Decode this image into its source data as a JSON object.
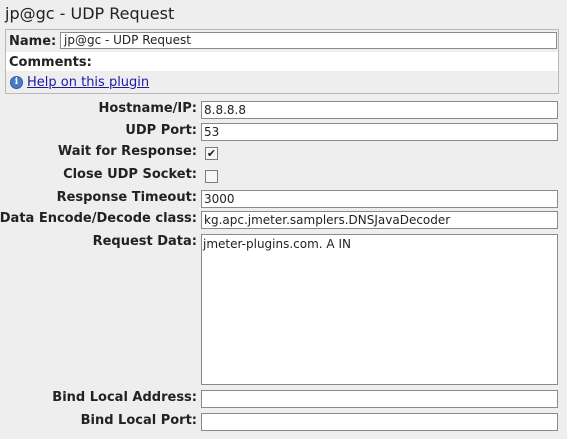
{
  "title": "jp@gc - UDP Request",
  "name_label": "Name:",
  "name_value": "jp@gc - UDP Request",
  "comments_label": "Comments:",
  "help_icon": "info-icon",
  "help_link": "Help on this plugin",
  "fields": {
    "hostname": {
      "label": "Hostname/IP:",
      "value": "8.8.8.8"
    },
    "udp_port": {
      "label": "UDP Port:",
      "value": "53"
    },
    "wait_response": {
      "label": "Wait for Response:",
      "checked": true
    },
    "close_socket": {
      "label": "Close UDP Socket:",
      "checked": false
    },
    "response_timeout": {
      "label": "Response Timeout:",
      "value": "3000"
    },
    "encode_class": {
      "label": "Data Encode/Decode class:",
      "value": "kg.apc.jmeter.samplers.DNSJavaDecoder"
    },
    "request_data": {
      "label": "Request Data:",
      "value": "jmeter-plugins.com. A IN"
    },
    "bind_address": {
      "label": "Bind Local Address:",
      "value": ""
    },
    "bind_port": {
      "label": "Bind Local Port:",
      "value": ""
    }
  },
  "checkmark": "✔"
}
